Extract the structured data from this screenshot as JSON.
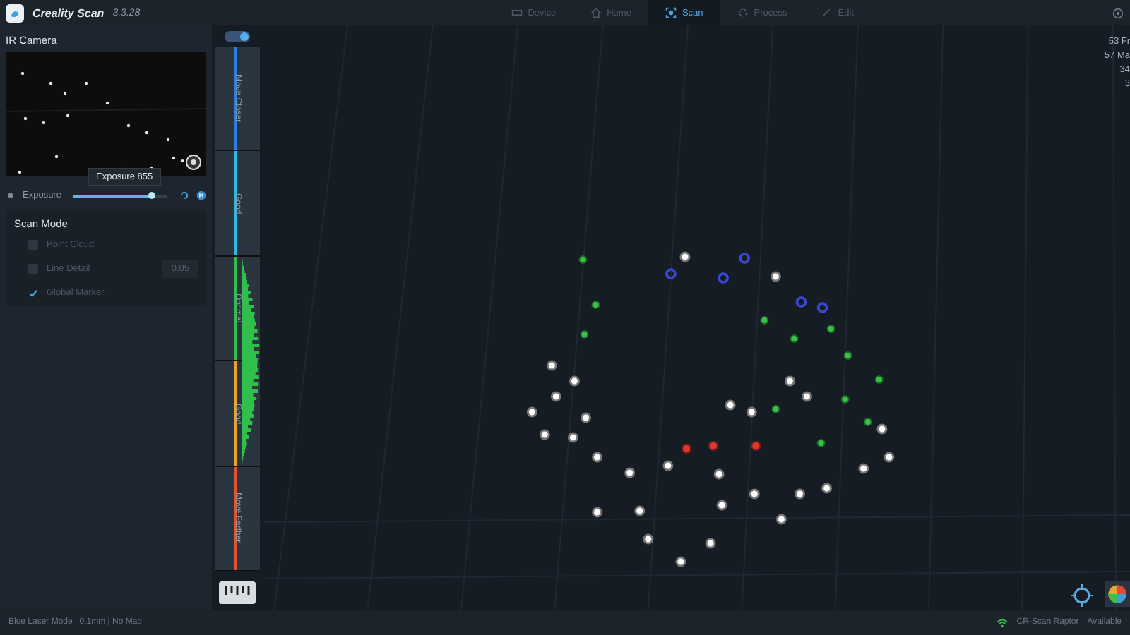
{
  "app": {
    "name": "Creality Scan",
    "version": "3.3.28"
  },
  "tabs": [
    {
      "label": "Device",
      "selected": false
    },
    {
      "label": "Home",
      "selected": false
    },
    {
      "label": "Scan",
      "selected": true
    },
    {
      "label": "Process",
      "selected": false
    },
    {
      "label": "Edit",
      "selected": false
    }
  ],
  "ir_camera": {
    "title": "IR Camera",
    "tooltip": "Exposure 855",
    "exposure": {
      "label": "Exposure",
      "level": 0.85
    }
  },
  "scan_mode": {
    "title": "Scan Mode",
    "options": [
      {
        "label": "Point Cloud",
        "checked": false
      },
      {
        "label": "Line Detail",
        "checked": false,
        "value": "0.05"
      },
      {
        "label": "Global Marker",
        "checked": true
      }
    ]
  },
  "distance_guide": {
    "toggle_on": true,
    "zones": [
      {
        "label": "Move Closer",
        "color": "#2f7fe0"
      },
      {
        "label": "Good",
        "color": "#2fb8e0"
      },
      {
        "label": "Optimal",
        "color": "#2fbf4a"
      },
      {
        "label": "Good",
        "color": "#e8a531"
      },
      {
        "label": "Move Farther",
        "color": "#e0552f"
      }
    ]
  },
  "stats": [
    "53 Fr",
    "57 Ma",
    "34",
    "3"
  ],
  "status_bar": {
    "left": "Blue Laser Mode | 0.1mm | No Map",
    "device": "CR-Scan Raptor",
    "right": "Available"
  }
}
